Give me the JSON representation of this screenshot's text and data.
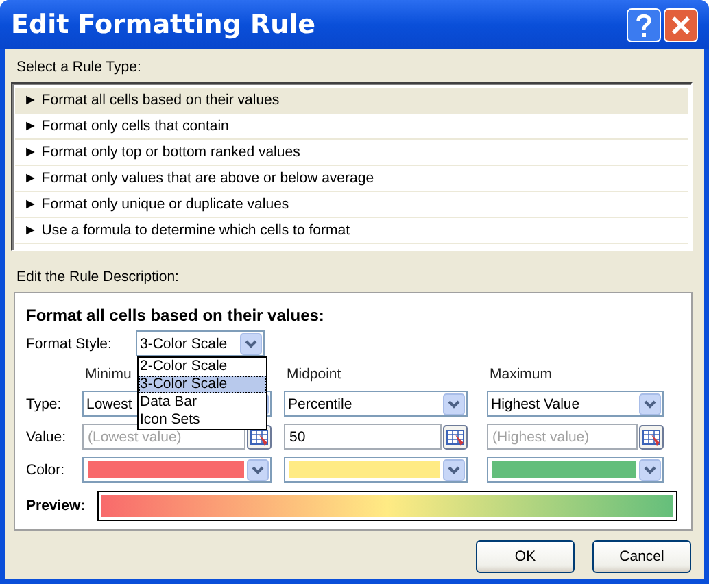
{
  "window": {
    "title": "Edit Formatting Rule"
  },
  "rule_type": {
    "label": "Select a Rule Type:",
    "items": [
      {
        "label": "► Format all cells based on their values",
        "selected": true
      },
      {
        "label": "► Format only cells that contain",
        "selected": false
      },
      {
        "label": "► Format only top or bottom ranked values",
        "selected": false
      },
      {
        "label": "► Format only values that are above or below average",
        "selected": false
      },
      {
        "label": "► Format only unique or duplicate values",
        "selected": false
      },
      {
        "label": "► Use a formula to determine which cells to format",
        "selected": false
      }
    ]
  },
  "description": {
    "label": "Edit the Rule Description:",
    "heading": "Format all cells based on their values:",
    "format_style": {
      "label": "Format Style:",
      "value": "3-Color Scale",
      "open": true,
      "options": [
        {
          "label": "2-Color Scale",
          "selected": false
        },
        {
          "label": "3-Color Scale",
          "selected": true
        },
        {
          "label": "Data Bar",
          "selected": false
        },
        {
          "label": "Icon Sets",
          "selected": false
        }
      ]
    },
    "row_labels": [
      "Type:",
      "Value:",
      "Color:"
    ],
    "columns": [
      {
        "heading": "Minimu",
        "type": "Lowest",
        "placeholder": "(Lowest value)",
        "color": "#f8696b"
      },
      {
        "heading": "Midpoint",
        "type": "Percentile",
        "value": "50",
        "color": "#ffeb84"
      },
      {
        "heading": "Maximum",
        "type": "Highest Value",
        "placeholder": "(Highest value)",
        "color": "#63be7b"
      }
    ],
    "preview_label": "Preview:"
  },
  "buttons": [
    "OK",
    "Cancel"
  ]
}
